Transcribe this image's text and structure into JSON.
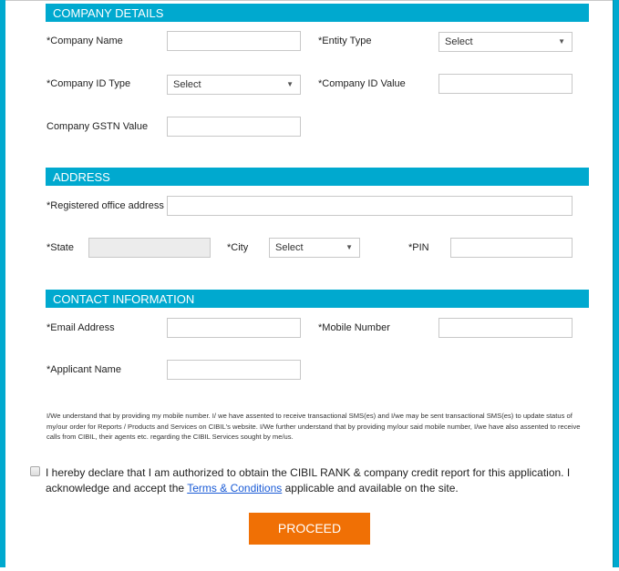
{
  "sections": {
    "company": "COMPANY DETAILS",
    "address": "ADDRESS",
    "contact": "CONTACT INFORMATION"
  },
  "company": {
    "name_label": "*Company Name",
    "name_value": "",
    "entity_label": "*Entity Type",
    "entity_value": "Select",
    "idtype_label": "*Company ID Type",
    "idtype_value": "Select",
    "idvalue_label": "*Company ID Value",
    "idvalue_value": "",
    "gstn_label": "Company GSTN Value",
    "gstn_value": ""
  },
  "address": {
    "office_label": "*Registered office address",
    "office_value": "",
    "state_label": "*State",
    "state_value": "",
    "city_label": "*City",
    "city_value": "Select",
    "pin_label": "*PIN",
    "pin_value": ""
  },
  "contact": {
    "email_label": "*Email Address",
    "email_value": "",
    "mobile_label": "*Mobile Number",
    "mobile_value": "",
    "applicant_label": "*Applicant Name",
    "applicant_value": ""
  },
  "consent_text": "I/We understand that by providing my mobile number. I/ we have assented to receive transactional SMS(es) and I/we may be sent transactional SMS(es) to update status of my/our order for Reports / Products and Services on CIBIL's website. I/We further understand that by providing my/our said mobile number, I/we have also assented to receive calls from CIBIL, their agents etc. regarding the CIBIL Services sought by me/us.",
  "declaration": {
    "before": "I hereby declare that I am authorized to obtain the CIBIL RANK & company credit report for this application. I acknowledge and accept the ",
    "link": "Terms & Conditions",
    "after": " applicable and available on the site.",
    "checked": false
  },
  "proceed_label": "PROCEED",
  "dropdown_arrow": "▼"
}
